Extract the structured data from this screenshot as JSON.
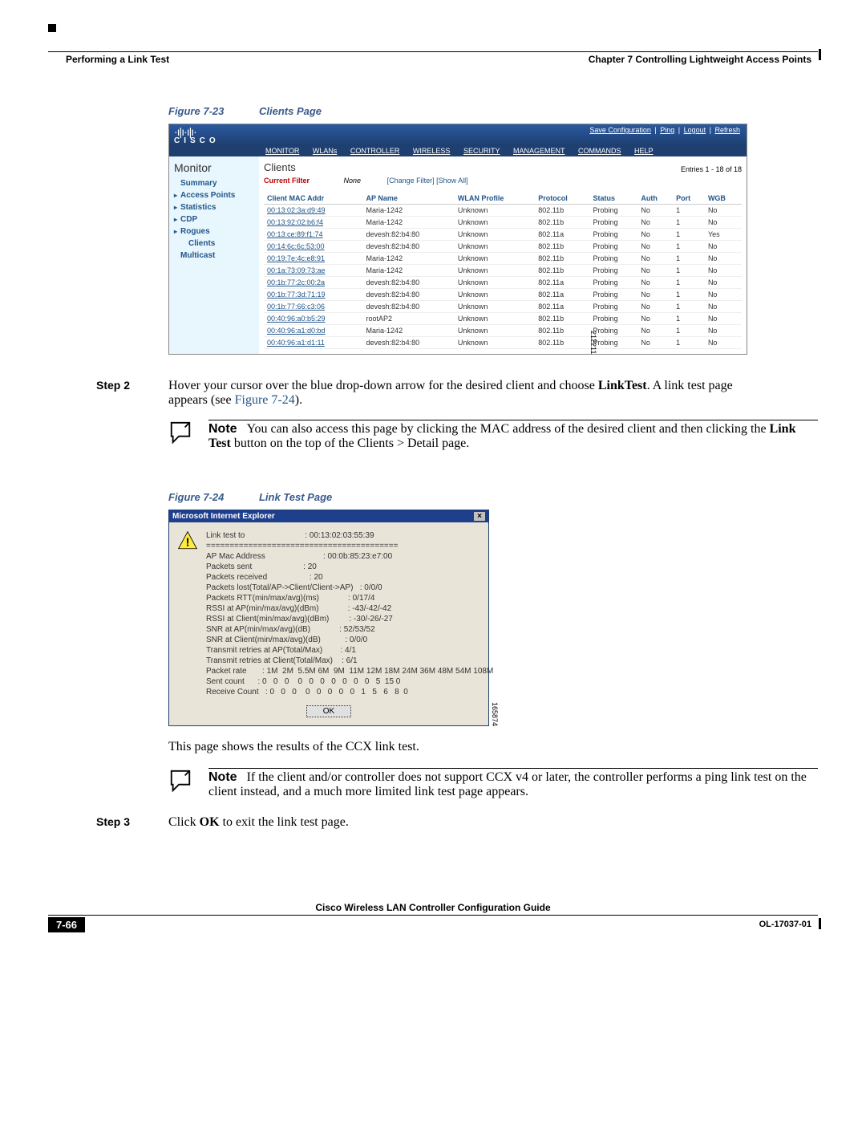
{
  "header": {
    "chapter": "Chapter 7      Controlling Lightweight Access Points",
    "section": "Performing a Link Test"
  },
  "figure23": {
    "caption_label": "Figure 7-23",
    "caption_title": "Clients Page",
    "fig_id": "212211",
    "top_links": [
      "Save Configuration",
      "Ping",
      "Logout",
      "Refresh"
    ],
    "nav": [
      "MONITOR",
      "WLANs",
      "CONTROLLER",
      "WIRELESS",
      "SECURITY",
      "MANAGEMENT",
      "COMMANDS",
      "HELP"
    ],
    "sidebar_title": "Monitor",
    "sidebar": {
      "summary": "Summary",
      "items": [
        "Access Points",
        "Statistics",
        "CDP",
        "Rogues"
      ],
      "clients": "Clients",
      "multicast": "Multicast"
    },
    "main_title": "Clients",
    "entries": "Entries 1 - 18 of 18",
    "filter_label": "Current Filter",
    "filter_value": "None",
    "filter_links": "[Change Filter] [Show All]",
    "columns": [
      "Client MAC Addr",
      "AP Name",
      "WLAN Profile",
      "Protocol",
      "Status",
      "Auth",
      "Port",
      "WGB"
    ],
    "rows": [
      {
        "mac": "00:13:02:3a:d9:49",
        "ap": "Maria-1242",
        "wlan": "Unknown",
        "proto": "802.11b",
        "status": "Probing",
        "auth": "No",
        "port": "1",
        "wgb": "No"
      },
      {
        "mac": "00:13:92:02:b6:f4",
        "ap": "Maria-1242",
        "wlan": "Unknown",
        "proto": "802.11b",
        "status": "Probing",
        "auth": "No",
        "port": "1",
        "wgb": "No"
      },
      {
        "mac": "00:13:ce:89:f1:74",
        "ap": "devesh:82:b4:80",
        "wlan": "Unknown",
        "proto": "802.11a",
        "status": "Probing",
        "auth": "No",
        "port": "1",
        "wgb": "Yes"
      },
      {
        "mac": "00:14:6c:6c:53:00",
        "ap": "devesh:82:b4:80",
        "wlan": "Unknown",
        "proto": "802.11b",
        "status": "Probing",
        "auth": "No",
        "port": "1",
        "wgb": "No"
      },
      {
        "mac": "00:19:7e:4c:e8:91",
        "ap": "Maria-1242",
        "wlan": "Unknown",
        "proto": "802.11b",
        "status": "Probing",
        "auth": "No",
        "port": "1",
        "wgb": "No"
      },
      {
        "mac": "00:1a:73:09:73:ae",
        "ap": "Maria-1242",
        "wlan": "Unknown",
        "proto": "802.11b",
        "status": "Probing",
        "auth": "No",
        "port": "1",
        "wgb": "No"
      },
      {
        "mac": "00:1b:77:2c:00:2a",
        "ap": "devesh:82:b4:80",
        "wlan": "Unknown",
        "proto": "802.11a",
        "status": "Probing",
        "auth": "No",
        "port": "1",
        "wgb": "No"
      },
      {
        "mac": "00:1b:77:3d:71:19",
        "ap": "devesh:82:b4:80",
        "wlan": "Unknown",
        "proto": "802.11a",
        "status": "Probing",
        "auth": "No",
        "port": "1",
        "wgb": "No"
      },
      {
        "mac": "00:1b:77:66:c3:06",
        "ap": "devesh:82:b4:80",
        "wlan": "Unknown",
        "proto": "802.11a",
        "status": "Probing",
        "auth": "No",
        "port": "1",
        "wgb": "No"
      },
      {
        "mac": "00:40:96:a0:b5:29",
        "ap": "rootAP2",
        "wlan": "Unknown",
        "proto": "802.11b",
        "status": "Probing",
        "auth": "No",
        "port": "1",
        "wgb": "No"
      },
      {
        "mac": "00:40:96:a1:d0:bd",
        "ap": "Maria-1242",
        "wlan": "Unknown",
        "proto": "802.11b",
        "status": "Probing",
        "auth": "No",
        "port": "1",
        "wgb": "No"
      },
      {
        "mac": "00:40:96:a1:d1:11",
        "ap": "devesh:82:b4:80",
        "wlan": "Unknown",
        "proto": "802.11b",
        "status": "Probing",
        "auth": "No",
        "port": "1",
        "wgb": "No"
      }
    ]
  },
  "step2": {
    "label": "Step 2",
    "text_before": "Hover your cursor over the blue drop-down arrow for the desired client and choose ",
    "bold1": "LinkTest",
    "text_mid": ". A link test page appears (see ",
    "link": "Figure 7-24",
    "text_after": ")."
  },
  "note1": {
    "label": "Note",
    "text_before": "You can also access this page by clicking the MAC address of the desired client and then clicking the ",
    "bold1": "Link Test",
    "text_after": " button on the top of the Clients > Detail page."
  },
  "figure24": {
    "caption_label": "Figure 7-24",
    "caption_title": "Link Test Page",
    "fig_id": "165874",
    "dialog_title": "Microsoft Internet Explorer",
    "close": "×",
    "content": "Link test to                           : 00:13:02:03:55:39\n=========================================\nAP Mac Address                          : 00:0b:85:23:e7:00\nPackets sent                       : 20\nPackets received                   : 20\nPackets lost(Total/AP->Client/Client->AP)   : 0/0/0\nPackets RTT(min/max/avg)(ms)             : 0/17/4\nRSSI at AP(min/max/avg)(dBm)             : -43/-42/-42\nRSSI at Client(min/max/avg)(dBm)         : -30/-26/-27\nSNR at AP(min/max/avg)(dB)             : 52/53/52\nSNR at Client(min/max/avg)(dB)           : 0/0/0\nTransmit retries at AP(Total/Max)        : 4/1\nTransmit retries at Client(Total/Max)    : 6/1\nPacket rate       : 1M  2M  5.5M 6M  9M  11M 12M 18M 24M 36M 48M 54M 108M\nSent count      : 0   0   0    0   0   0   0   0   0   0   5  15 0\nReceive Count   : 0   0   0    0   0   0   0   0   1   5   6   8  0",
    "ok": "OK"
  },
  "after_fig24": "This page shows the results of the CCX link test.",
  "note2": {
    "label": "Note",
    "text": "If the client and/or controller does not support CCX v4 or later, the controller performs a ping link test on the client instead, and a much more limited link test page appears."
  },
  "step3": {
    "label": "Step 3",
    "before": "Click ",
    "bold": "OK",
    "after": " to exit the link test page."
  },
  "footer": {
    "title": "Cisco Wireless LAN Controller Configuration Guide",
    "page": "7-66",
    "ol": "OL-17037-01"
  }
}
